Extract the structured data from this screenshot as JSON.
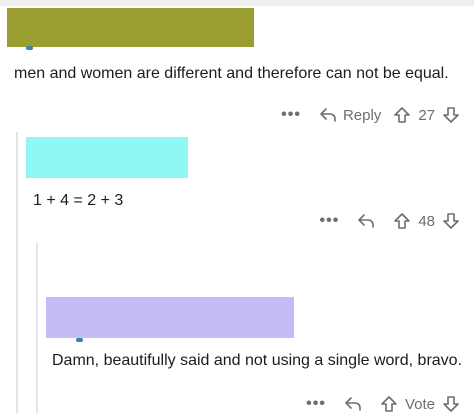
{
  "comments": [
    {
      "text": "men and women are different and therefore can not be equal.",
      "actions": {
        "more": "•••",
        "reply_label": "Reply",
        "score": "27"
      }
    },
    {
      "text": "1 + 4 = 2 + 3",
      "actions": {
        "more": "•••",
        "score": "48"
      }
    },
    {
      "text": "Damn, beautifully said and not using a single word, bravo.",
      "actions": {
        "more": "•••",
        "score": "Vote"
      }
    }
  ],
  "colors": {
    "redaction_1": "#9a9e30",
    "redaction_2": "#8ff7f4",
    "redaction_3": "#c4bcf7",
    "action_gray": "#6b6e72"
  },
  "icons": [
    "reply-arrow-icon",
    "upvote-arrow-icon",
    "downvote-arrow-icon",
    "more-options-icon"
  ]
}
